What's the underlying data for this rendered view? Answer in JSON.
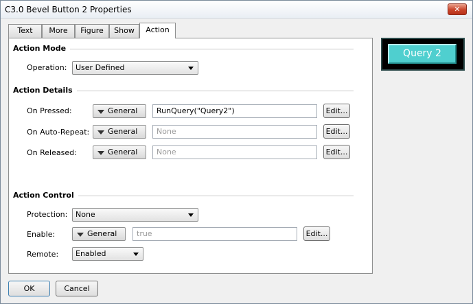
{
  "window": {
    "title": "C3.0 Bevel Button 2 Properties",
    "close_label": "✕"
  },
  "tabs": [
    {
      "label": "Text"
    },
    {
      "label": "More"
    },
    {
      "label": "Figure"
    },
    {
      "label": "Show"
    },
    {
      "label": "Action",
      "active": true
    }
  ],
  "action_mode": {
    "title": "Action Mode",
    "operation_label": "Operation:",
    "operation_value": "User Defined"
  },
  "action_details": {
    "title": "Action Details",
    "rows": [
      {
        "label": "On Pressed:",
        "type": "General",
        "value": "RunQuery(\"Query2\")",
        "edit": "Edit..."
      },
      {
        "label": "On Auto-Repeat:",
        "type": "General",
        "value": "None",
        "edit": "Edit..."
      },
      {
        "label": "On Released:",
        "type": "General",
        "value": "None",
        "edit": "Edit..."
      }
    ]
  },
  "action_control": {
    "title": "Action Control",
    "protection_label": "Protection:",
    "protection_value": "None",
    "enable_label": "Enable:",
    "enable_type": "General",
    "enable_value": "true",
    "enable_edit": "Edit...",
    "remote_label": "Remote:",
    "remote_value": "Enabled"
  },
  "preview": {
    "label": "Query 2",
    "bg_color": "#4fcfcf"
  },
  "footer": {
    "ok": "OK",
    "cancel": "Cancel"
  }
}
